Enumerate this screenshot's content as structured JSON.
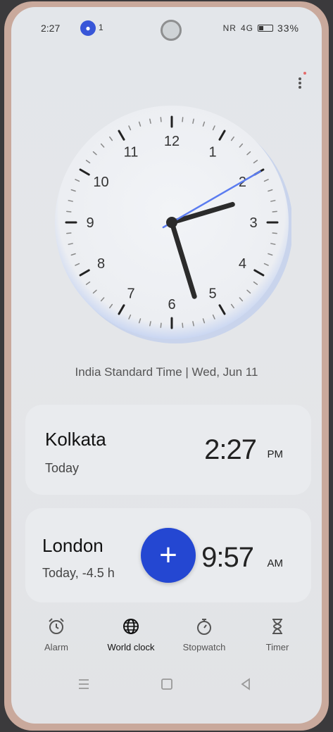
{
  "status_bar": {
    "time": "2:27",
    "notification_count": "1",
    "network": "NR",
    "signal": "4G",
    "battery": "33%"
  },
  "clock": {
    "numerals": [
      "12",
      "1",
      "2",
      "3",
      "4",
      "5",
      "6",
      "7",
      "8",
      "9",
      "10",
      "11"
    ],
    "hour": 2,
    "minute": 27,
    "second": 10,
    "caption": "India Standard Time | Wed, Jun 11"
  },
  "cities": [
    {
      "name": "Kolkata",
      "day": "Today",
      "time": "2:27",
      "ampm": "PM"
    },
    {
      "name": "London",
      "day": "Today, -4.5 h",
      "time": "9:57",
      "ampm": "AM"
    }
  ],
  "add_button": "+",
  "tabs": [
    {
      "label": "Alarm",
      "icon": "alarm-icon"
    },
    {
      "label": "World clock",
      "icon": "globe-icon"
    },
    {
      "label": "Stopwatch",
      "icon": "stopwatch-icon"
    },
    {
      "label": "Timer",
      "icon": "hourglass-icon"
    }
  ],
  "colors": {
    "accent": "#2447d2",
    "second_hand": "#5b7cf0",
    "hands": "#2b2b2b"
  }
}
